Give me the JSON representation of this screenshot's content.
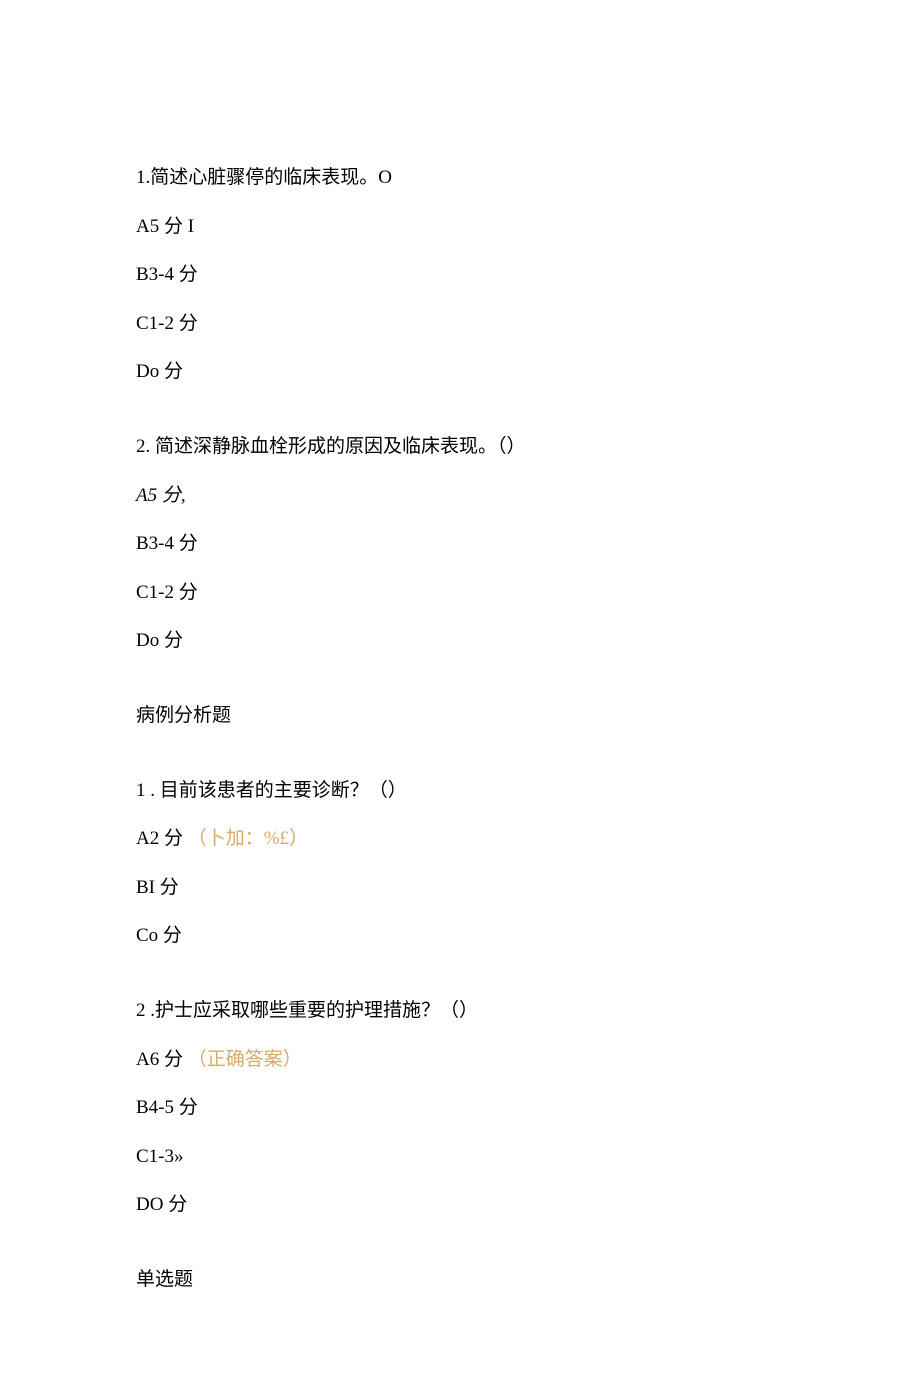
{
  "q1": {
    "prompt": "1.简述心脏骤停的临床表现。O",
    "a": "A5 分 I",
    "b": "B3-4 分",
    "c": "C1-2 分",
    "d": "Do 分"
  },
  "q2": {
    "prompt": "2. 简述深静脉血栓形成的原因及临床表现。（）",
    "a": "A5 分,",
    "b": "B3-4 分",
    "c": "C1-2 分",
    "d": "Do 分"
  },
  "section_case": "病例分析题",
  "q3": {
    "prompt": "1 . 目前该患者的主要诊断？（）",
    "a": "A2 分",
    "a_annotation": "（卜加：%£）",
    "b": "BI 分",
    "c": "Co 分"
  },
  "q4": {
    "prompt": "2   .护士应采取哪些重要的护理措施？（）",
    "a": "A6 分",
    "a_annotation": "（正确答案）",
    "b": "B4-5 分",
    "c": "C1-3»",
    "d": "DO 分"
  },
  "section_single": "单选题"
}
